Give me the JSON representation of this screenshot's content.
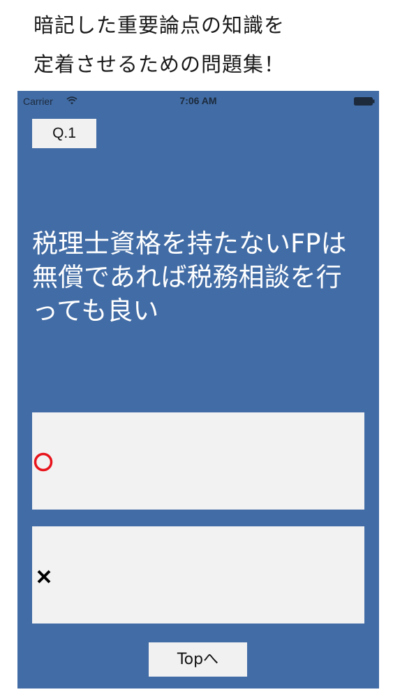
{
  "headline": {
    "line1": "暗記した重要論点の知識を",
    "line2": "定着させるための問題集！"
  },
  "status_bar": {
    "carrier": "Carrier",
    "time": "7:06 AM",
    "wifi_icon": "wifi-icon",
    "battery_icon": "battery-icon"
  },
  "question": {
    "number_label": "Q.1",
    "text": "税理士資格を持たないFPは無償であれば税務相談を行っても良い"
  },
  "answers": {
    "true_icon": "circle-icon",
    "false_icon": "cross-icon",
    "true_color": "#e8141c",
    "false_color": "#000000"
  },
  "navigation": {
    "top_button_label": "Topへ"
  },
  "colors": {
    "background": "#426ca5",
    "button_bg": "#f2f2f2"
  }
}
